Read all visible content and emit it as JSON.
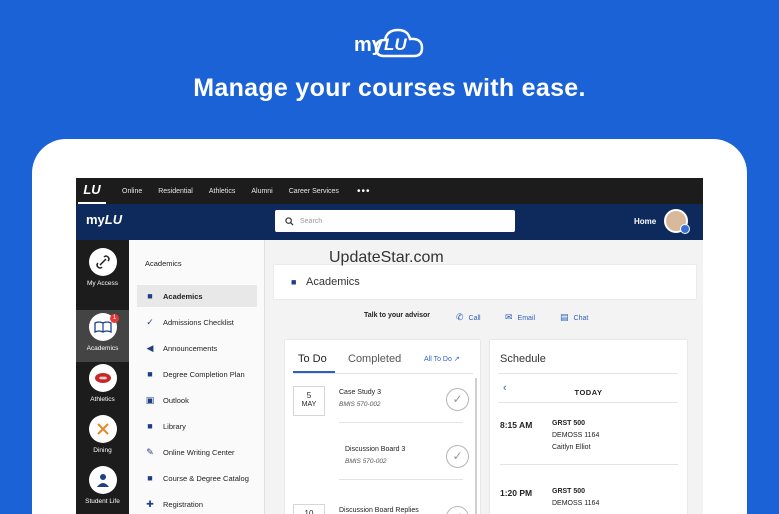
{
  "promo": {
    "logo_my": "my",
    "logo_lu": "LU",
    "headline": "Manage your courses with ease."
  },
  "topnav": {
    "mark": "LU",
    "links": [
      "Online",
      "Residential",
      "Athletics",
      "Alumni",
      "Career Services"
    ],
    "more": "•••"
  },
  "header": {
    "logo_my": "my",
    "logo_lu": "LU",
    "search_placeholder": "Search",
    "home_label": "Home"
  },
  "rail": {
    "items": [
      {
        "label": "My Access",
        "icon": "link-icon"
      },
      {
        "label": "Academics",
        "icon": "book-icon",
        "badge": "1"
      },
      {
        "label": "Athletics",
        "icon": "football-icon"
      },
      {
        "label": "Dining",
        "icon": "utensils-icon"
      },
      {
        "label": "Student Life",
        "icon": "student-icon"
      }
    ]
  },
  "submenu": {
    "title": "Academics",
    "items": [
      {
        "label": "Academics",
        "icon": "box-icon"
      },
      {
        "label": "Admissions Checklist",
        "icon": "check-icon"
      },
      {
        "label": "Announcements",
        "icon": "megaphone-icon"
      },
      {
        "label": "Degree Completion Plan",
        "icon": "box-icon"
      },
      {
        "label": "Outlook",
        "icon": "outlook-icon"
      },
      {
        "label": "Library",
        "icon": "box-icon"
      },
      {
        "label": "Online Writing Center",
        "icon": "pencil-icon"
      },
      {
        "label": "Course & Degree Catalog",
        "icon": "box-icon"
      },
      {
        "label": "Registration",
        "icon": "plus-doc-icon"
      }
    ]
  },
  "main": {
    "watermark": "UpdateStar.com",
    "card_title": "Academics",
    "advisor": {
      "label": "Talk to your advisor",
      "call": "Call",
      "email": "Email",
      "chat": "Chat"
    },
    "todo": {
      "tab_todo": "To Do",
      "tab_completed": "Completed",
      "all_link": "All To Do",
      "tasks": [
        {
          "day": "5",
          "month": "MAY",
          "name": "Case Study 3",
          "code": "BMIS 570-002"
        },
        {
          "day": "",
          "month": "",
          "name": "Discussion Board 3",
          "code": "BMIS 570-002"
        },
        {
          "day": "10",
          "month": "",
          "name": "Discussion Board Replies",
          "code": ""
        }
      ]
    },
    "schedule": {
      "title": "Schedule",
      "today": "TODAY",
      "events": [
        {
          "time": "8:15 AM",
          "course": "GRST 500",
          "room": "DEMOSS 1164",
          "instructor": "Caitlyn Elliot"
        },
        {
          "time": "1:20 PM",
          "course": "GRST 500",
          "room": "DEMOSS 1164",
          "instructor": ""
        }
      ]
    }
  }
}
